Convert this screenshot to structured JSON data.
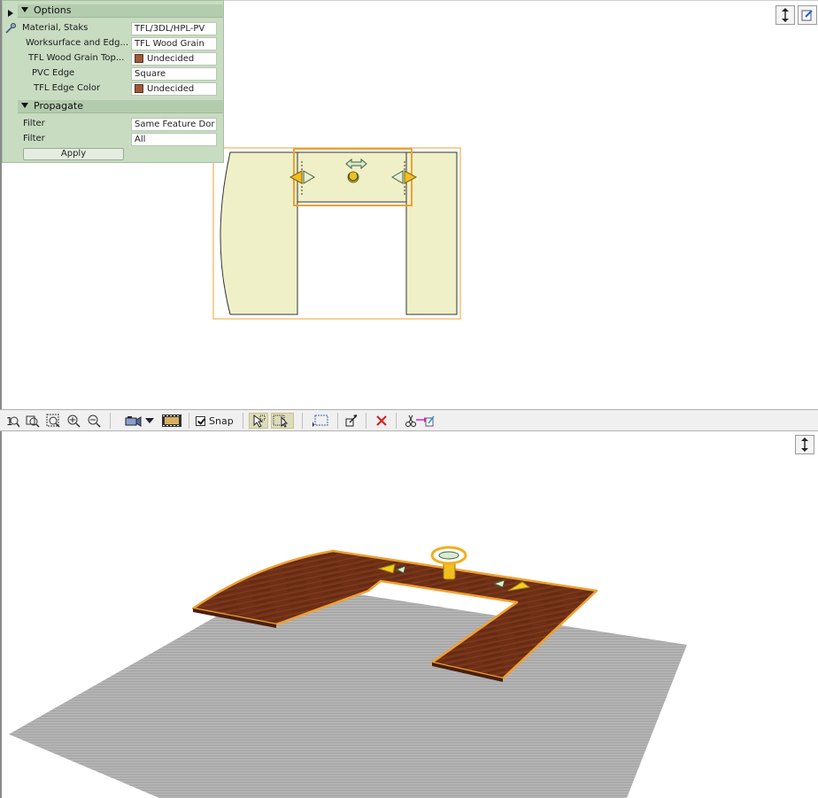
{
  "options_panel": {
    "section_options": "Options",
    "rows": [
      {
        "label": "Material, Staks",
        "value": "TFL/3DL/HPL-PV",
        "swatch": false
      },
      {
        "label": "Worksurface and Edg...",
        "value": "TFL Wood Grain",
        "swatch": false
      },
      {
        "label": "TFL Wood Grain Top...",
        "value": "Undecided",
        "swatch": true
      },
      {
        "label": "PVC Edge",
        "value": "Square",
        "swatch": false
      },
      {
        "label": "TFL Edge Color",
        "value": "Undecided",
        "swatch": true
      }
    ],
    "section_propagate": "Propagate",
    "filters": [
      {
        "label": "Filter",
        "value": "Same Feature Dor"
      },
      {
        "label": "Filter",
        "value": "All"
      }
    ],
    "apply_label": "Apply"
  },
  "toolbar": {
    "snap_label": "Snap",
    "snap_checked": true,
    "icons": [
      "zoom-1-icon",
      "zoom-window-icon",
      "zoom-extents-icon",
      "zoom-in-icon",
      "zoom-out-icon",
      "camera-icon",
      "camera-dropdown-icon",
      "filmstrip-icon",
      "select-add-icon",
      "select-toggle-icon",
      "marquee-select-icon",
      "move-arrange-icon",
      "delete-icon",
      "cut-paste-icon"
    ]
  },
  "colors": {
    "panel_bg": "#c8dcc2",
    "plan_fill": "#f0f0c8",
    "selection": "#f0a030",
    "wood": "#6b2e16",
    "floor": "#b0b0b0"
  }
}
